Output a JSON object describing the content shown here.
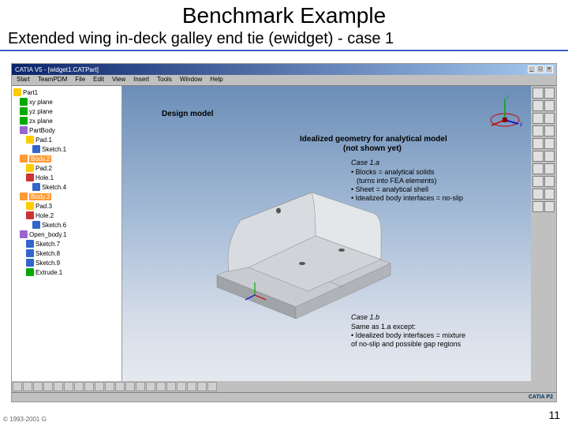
{
  "slide": {
    "title": "Benchmark Example",
    "subtitle": "Extended wing in-deck galley end tie (ewidget) - case 1",
    "copyright": "© 1993-2001 G",
    "page": "11"
  },
  "window": {
    "title": "CATIA V5 - [widget1.CATPart]",
    "catia_brand": "CATIA P2"
  },
  "menu": {
    "items": [
      "Start",
      "TeamPDM",
      "File",
      "Edit",
      "View",
      "Insert",
      "Tools",
      "Window",
      "Help"
    ]
  },
  "tree": {
    "items": [
      {
        "icon": "ti-yellow",
        "label": "Part1",
        "indent": 0
      },
      {
        "icon": "ti-green",
        "label": "xy plane",
        "indent": 1
      },
      {
        "icon": "ti-green",
        "label": "yz plane",
        "indent": 1
      },
      {
        "icon": "ti-green",
        "label": "zx plane",
        "indent": 1
      },
      {
        "icon": "ti-purple",
        "label": "PartBody",
        "indent": 1
      },
      {
        "icon": "ti-yellow",
        "label": "Pad.1",
        "indent": 2
      },
      {
        "icon": "ti-blue",
        "label": "Sketch.1",
        "indent": 3
      },
      {
        "icon": "ti-orange",
        "label": "Body.2",
        "indent": 1,
        "highlight": true
      },
      {
        "icon": "ti-yellow",
        "label": "Pad.2",
        "indent": 2
      },
      {
        "icon": "ti-red",
        "label": "Hole.1",
        "indent": 2
      },
      {
        "icon": "ti-blue",
        "label": "Sketch.4",
        "indent": 3
      },
      {
        "icon": "ti-orange",
        "label": "Body.3",
        "indent": 1,
        "highlight": true
      },
      {
        "icon": "ti-yellow",
        "label": "Pad.3",
        "indent": 2
      },
      {
        "icon": "ti-red",
        "label": "Hole.2",
        "indent": 2
      },
      {
        "icon": "ti-blue",
        "label": "Sketch.6",
        "indent": 3
      },
      {
        "icon": "ti-purple",
        "label": "Open_body.1",
        "indent": 1
      },
      {
        "icon": "ti-blue",
        "label": "Sketch.7",
        "indent": 2
      },
      {
        "icon": "ti-blue",
        "label": "Sketch.8",
        "indent": 2
      },
      {
        "icon": "ti-blue",
        "label": "Sketch.9",
        "indent": 2
      },
      {
        "icon": "ti-green",
        "label": "Extrude.1",
        "indent": 2
      }
    ]
  },
  "annotations": {
    "design_model": "Design model",
    "idealized_title": "Idealized geometry for analytical model",
    "idealized_sub": "(not shown yet)",
    "case1a_title": "Case 1.a",
    "case1a_b1": "• Blocks = analytical solids",
    "case1a_b1_sub": "(turns into FEA elements)",
    "case1a_b2": "• Sheet = analytical shell",
    "case1a_b3": "• Idealized body interfaces = no-slip",
    "case1b_title": "Case 1.b",
    "case1b_s1": "Same as 1.a except:",
    "case1b_b1": "• Idealized body interfaces = mixture",
    "case1b_b2": "of no-slip and possible gap regions"
  }
}
